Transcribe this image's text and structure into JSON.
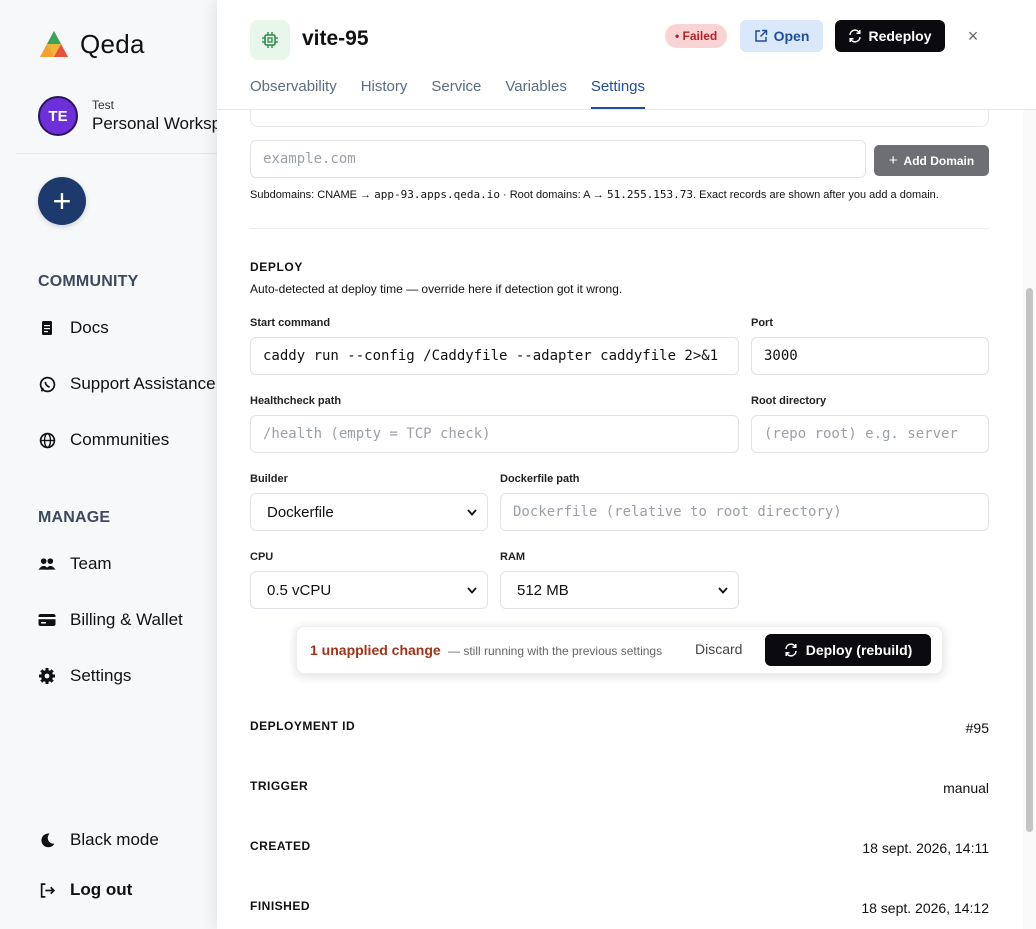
{
  "sidebar": {
    "app_name": "Qeda",
    "workspace": {
      "initials": "TE",
      "label": "Test",
      "name": "Personal Workspace"
    },
    "new_button": "+",
    "community_header": "COMMUNITY",
    "community": [
      {
        "label": "Docs",
        "icon": "docs-icon"
      },
      {
        "label": "Support Assistance",
        "icon": "whatsapp-icon"
      },
      {
        "label": "Communities",
        "icon": "globe-icon"
      }
    ],
    "manage_header": "MANAGE",
    "manage": [
      {
        "label": "Team",
        "icon": "team-icon"
      },
      {
        "label": "Billing & Wallet",
        "icon": "wallet-icon"
      },
      {
        "label": "Settings",
        "icon": "gear-icon"
      }
    ],
    "black_mode": "Black mode",
    "logout": "Log out"
  },
  "header": {
    "service_name": "vite-95",
    "status": "• Failed",
    "open_label": "Open",
    "redeploy_label": "Redeploy",
    "close_label": "×",
    "tabs": [
      "Observability",
      "History",
      "Service",
      "Variables",
      "Settings"
    ],
    "active_tab": "Settings"
  },
  "domains": {
    "placeholder": "example.com",
    "add_label": "Add Domain",
    "hint_prefix": "Subdomains: CNAME → ",
    "cname_target": "app-93.apps.qeda.io",
    "hint_mid": " · Root domains: A → ",
    "a_target": "51.255.153.73",
    "hint_suffix": ". Exact records are shown after you add a domain."
  },
  "deploy": {
    "title": "DEPLOY",
    "description": "Auto-detected at deploy time — override here if detection got it wrong.",
    "start_command_label": "Start command",
    "start_command": "caddy run --config /Caddyfile --adapter caddyfile 2>&1",
    "port_label": "Port",
    "port": "3000",
    "healthcheck_label": "Healthcheck path",
    "healthcheck_placeholder": "/health (empty = TCP check)",
    "root_dir_label": "Root directory",
    "root_dir_placeholder": "(repo root) e.g. server",
    "builder_label": "Builder",
    "builder": "Dockerfile",
    "dockerfile_label": "Dockerfile path",
    "dockerfile_placeholder": "Dockerfile (relative to root directory)",
    "cpu_label": "CPU",
    "cpu": "0.5 vCPU",
    "ram_label": "RAM",
    "ram": "512 MB"
  },
  "changes_bar": {
    "count_text": "1 unapplied change",
    "subtitle": "— still running with the previous settings",
    "discard": "Discard",
    "deploy": "Deploy (rebuild)"
  },
  "details": [
    {
      "label": "DEPLOYMENT ID",
      "value": "#95"
    },
    {
      "label": "TRIGGER",
      "value": "manual"
    },
    {
      "label": "CREATED",
      "value": "18 sept. 2026, 14:11"
    },
    {
      "label": "FINISHED",
      "value": "18 sept. 2026, 14:12"
    }
  ],
  "colors": {
    "accent": "#1d4f9a",
    "failed": "#b42323",
    "primary_button": "#0b0b0f",
    "avatar": "#6d2fd8"
  }
}
